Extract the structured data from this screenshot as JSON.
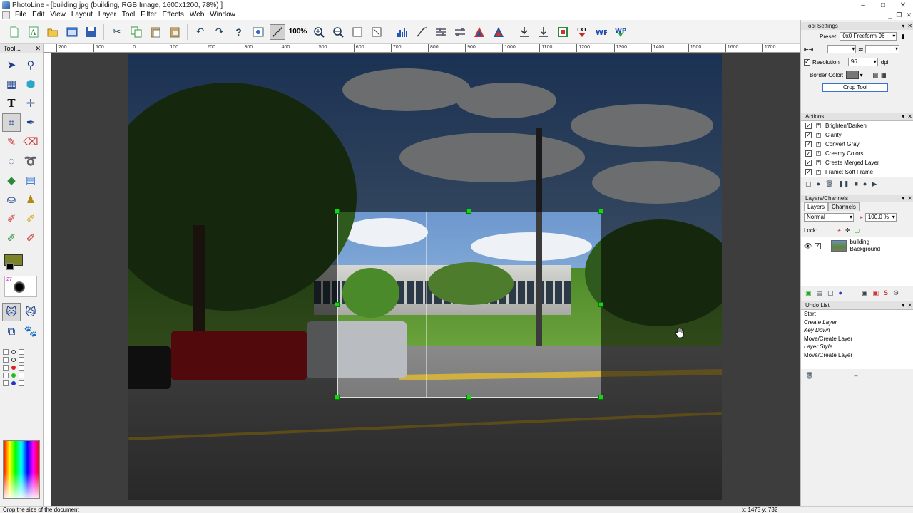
{
  "window": {
    "title": "PhotoLine - [building.jpg  (building, RGB Image, 1600x1200, 78%) ]",
    "controls": [
      "–",
      "□",
      "✕"
    ]
  },
  "menu": {
    "items": [
      "File",
      "Edit",
      "View",
      "Layout",
      "Layer",
      "Tool",
      "Filter",
      "Effects",
      "Web",
      "Window"
    ],
    "doc_controls": [
      "_",
      "❐",
      "✕"
    ]
  },
  "toolbar": {
    "zoom_label": "100%",
    "buttons": [
      "new-document",
      "text-document",
      "open-folder",
      "image-window",
      "save",
      "cut",
      "copy",
      "paste",
      "paste-new",
      "undo",
      "redo",
      "help",
      "fit-window",
      "measure",
      "zoom-in",
      "zoom-out",
      "actual-size",
      "fit-size",
      "histogram",
      "tonal-curve",
      "color-balance",
      "levels",
      "sharpen",
      "import",
      "export",
      "web-export",
      "text-frame",
      "wp-export",
      "wp-download"
    ]
  },
  "left_panel": {
    "header": "Tool...",
    "fg_color": "#7a8328",
    "brush_size": "27"
  },
  "ruler": {
    "ticks": [
      "200",
      "100",
      "0",
      "100",
      "200",
      "300",
      "400",
      "500",
      "600",
      "700",
      "800",
      "900",
      "1000",
      "1100",
      "1200",
      "1300",
      "1400",
      "1500",
      "1600",
      "1700"
    ]
  },
  "tool_settings": {
    "header": "Tool Settings",
    "preset_label": "Preset:",
    "preset_value": "0x0 Freeform-96",
    "resolution_label": "Resolution",
    "resolution_value": "96",
    "resolution_unit": "dpi",
    "border_color_label": "Border Color:",
    "crop_button": "Crop Tool"
  },
  "actions": {
    "header": "Actions",
    "items": [
      "Brighten/Darken",
      "Clarity",
      "Convert Gray",
      "Creamy Colors",
      "Create Merged Layer",
      "Frame: Soft Frame"
    ]
  },
  "layers": {
    "header": "Layers/Channels",
    "tabs": [
      "Layers",
      "Channels"
    ],
    "blend_mode": "Normal",
    "opacity": "100.0 %",
    "lock_label": "Lock:",
    "layer_name": "building",
    "layer_sub": "Background"
  },
  "undo": {
    "header": "Undo List",
    "items": [
      "Start",
      "Create Layer",
      "Key Down",
      "Move/Create Layer",
      "Layer Style...",
      "Move/Create Layer"
    ]
  },
  "status": {
    "text": "Crop the size of the document",
    "coords": "x: 1475 y: 732"
  },
  "colors": {
    "accent_green": "#14d414",
    "canvas_bg": "#3d3d3d"
  }
}
